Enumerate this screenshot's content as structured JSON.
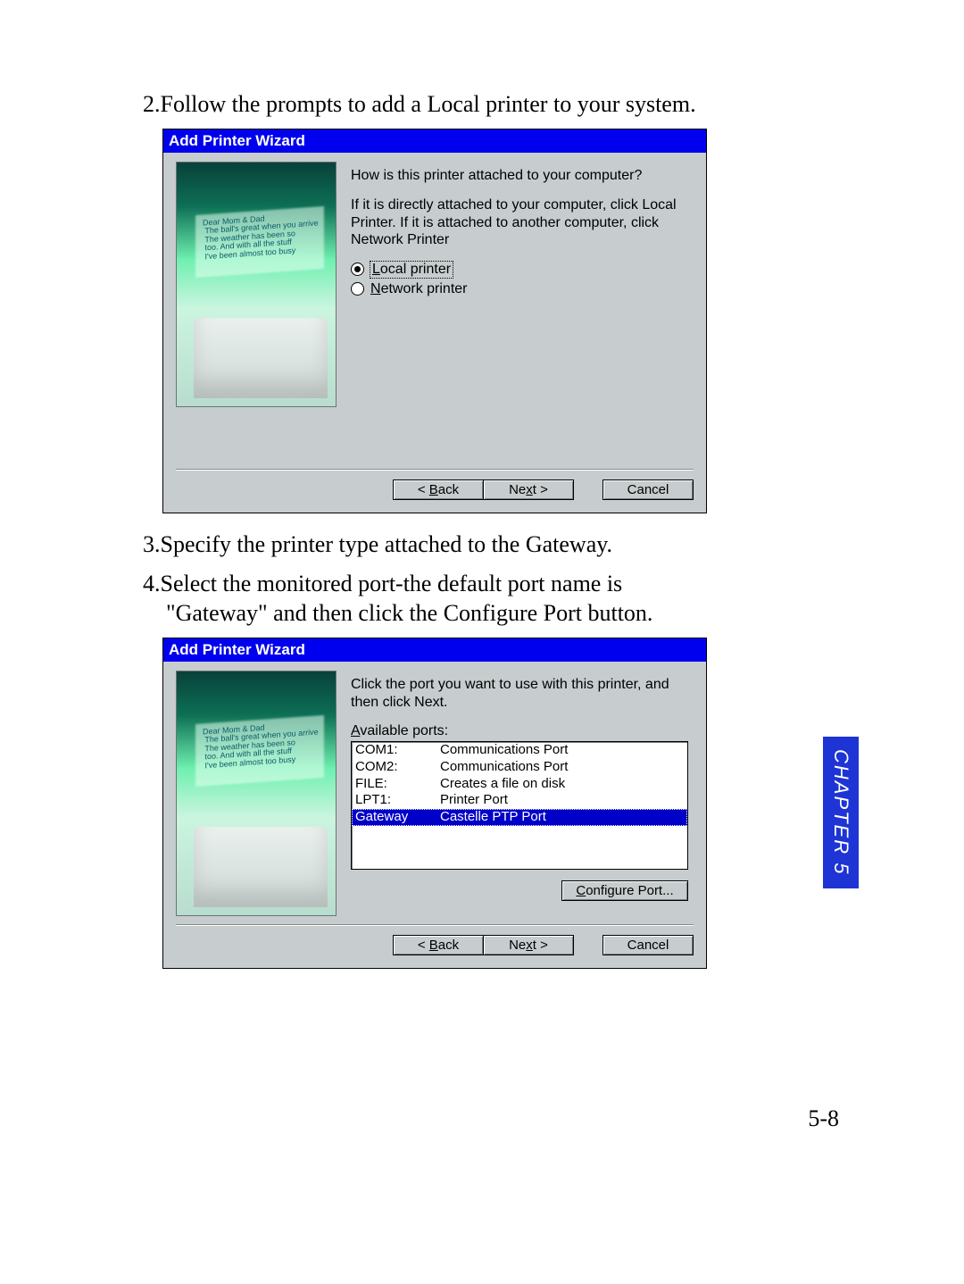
{
  "steps": {
    "s2": "2.Follow the prompts to add a Local printer to your system.",
    "s3": "3.Specify the printer type attached to the Gateway.",
    "s4a": "4.Select the monitored port-the default port name is",
    "s4b": "\"Gateway\" and then click the Configure Port button."
  },
  "wizard1": {
    "title": "Add Printer Wizard",
    "q": "How is this printer attached to your computer?",
    "info": "If it is directly attached to your computer, click Local Printer. If it is attached to another computer, click Network Printer",
    "opt_local_pre": "L",
    "opt_local_rest": "ocal printer",
    "opt_net_pre": "N",
    "opt_net_rest": "etwork printer",
    "back_lt": "< ",
    "back_pre": "B",
    "back_rest": "ack",
    "next_label": "Ne",
    "next_pre": "x",
    "next_rest": "t >",
    "cancel": "Cancel"
  },
  "wizard2": {
    "title": "Add Printer Wizard",
    "info": "Click the port you want to use with this printer, and then click Next.",
    "available_pre": "A",
    "available_rest": "vailable ports:",
    "ports": [
      {
        "name": "COM1:",
        "desc": "Communications Port"
      },
      {
        "name": "COM2:",
        "desc": "Communications Port"
      },
      {
        "name": "FILE:",
        "desc": "Creates a file on disk"
      },
      {
        "name": "LPT1:",
        "desc": "Printer Port"
      },
      {
        "name": "Gateway",
        "desc": "Castelle  PTP  Port"
      }
    ],
    "configure_pre": "C",
    "configure_rest": "onfigure Port..."
  },
  "art_note": "Dear Mom & Dad\n The ball's great when you arrive\n The weather has been so\n too. And with all the stuff\n I've been almost too busy",
  "side_tab": "CHAPTER 5",
  "page_number": "5-8"
}
